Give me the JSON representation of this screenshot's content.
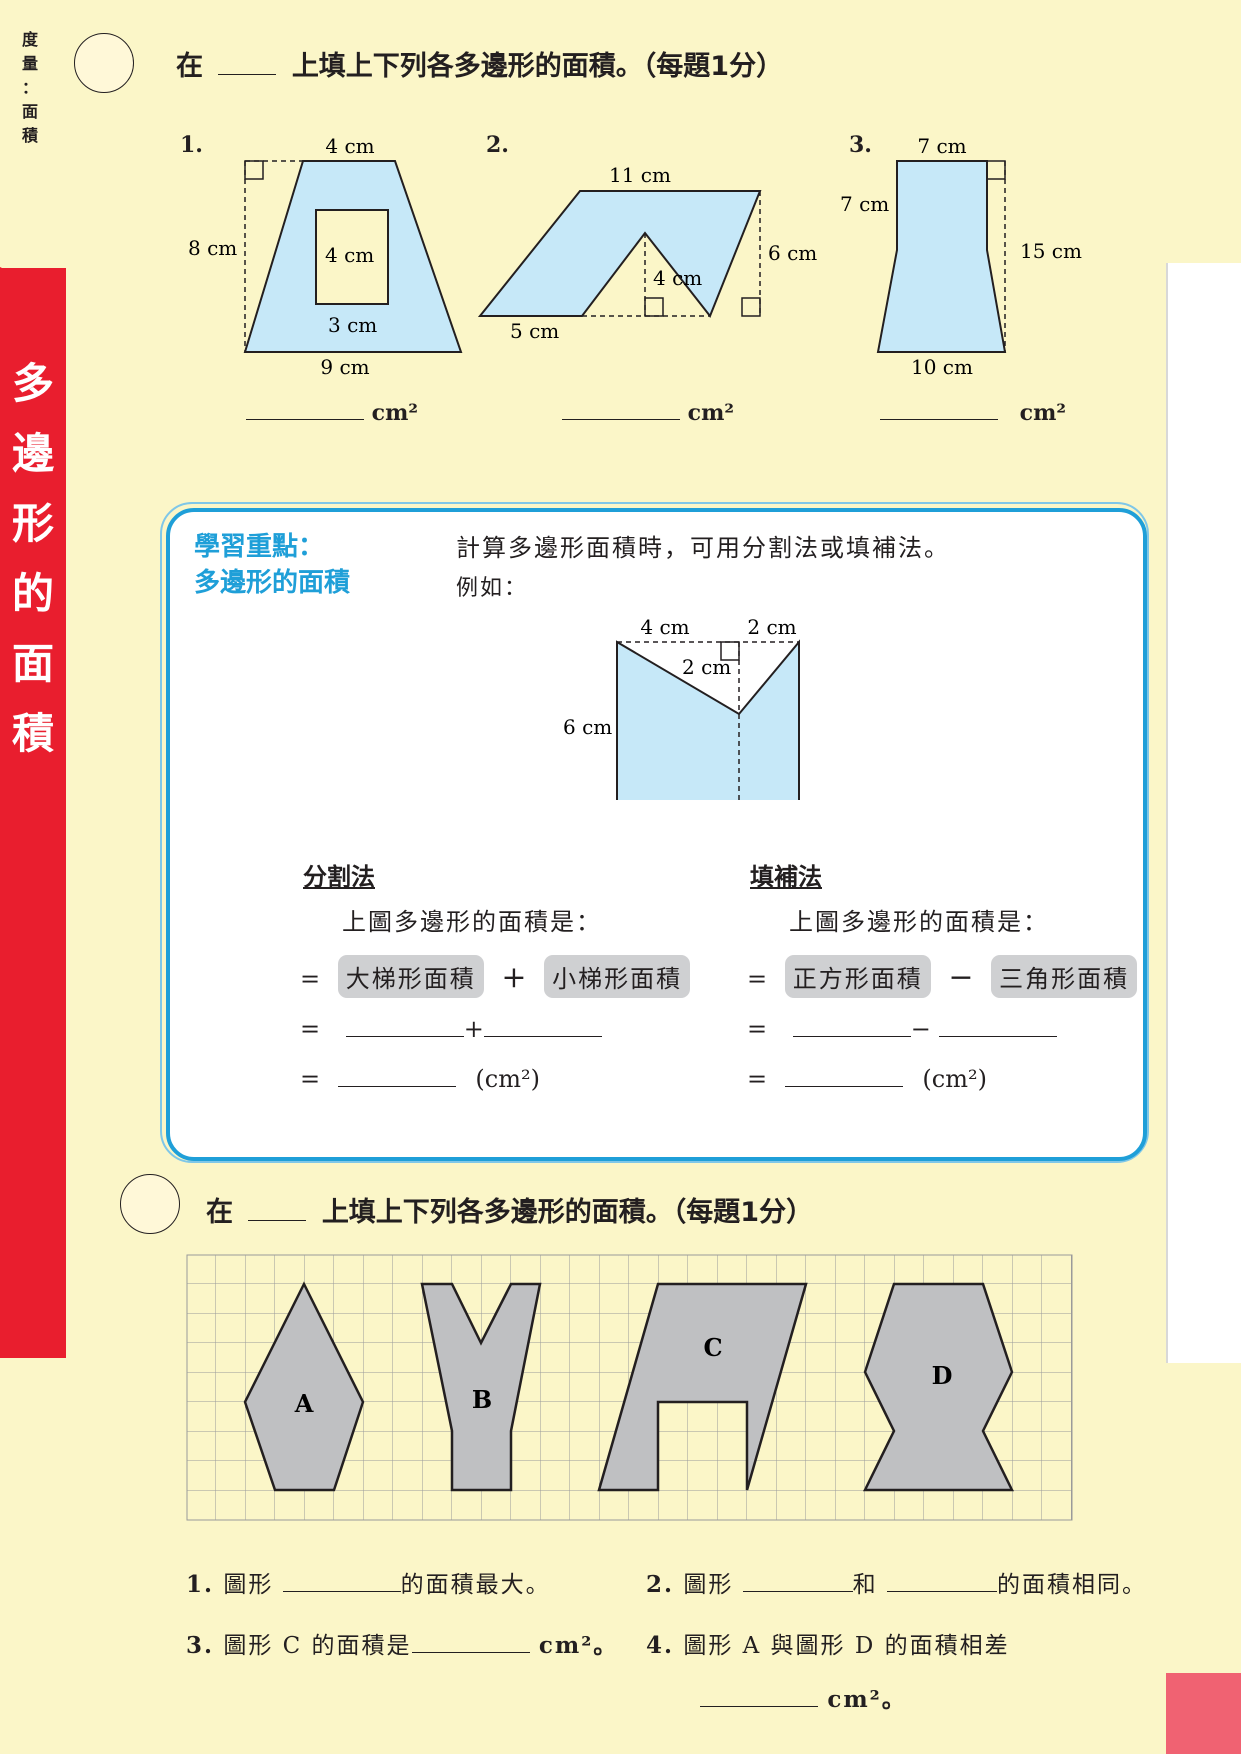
{
  "sidebar": {
    "top_chars": [
      "度",
      "量",
      "：",
      "面",
      "積"
    ],
    "tab_chars": [
      "多",
      "邊",
      "形",
      "的",
      "面",
      "積"
    ]
  },
  "section1": {
    "title_prefix": "在",
    "title_suffix": "上填上下列各多邊形的面積。（每題1分）",
    "questions": [
      {
        "num": "1.",
        "unit": "cm²",
        "labels": [
          "4 cm",
          "8 cm",
          "4 cm",
          "3 cm",
          "9 cm"
        ]
      },
      {
        "num": "2.",
        "unit": "cm²",
        "labels": [
          "11 cm",
          "6 cm",
          "4 cm",
          "5 cm"
        ]
      },
      {
        "num": "3.",
        "unit": "cm²",
        "labels": [
          "7 cm",
          "7 cm",
          "15 cm",
          "10 cm"
        ]
      }
    ]
  },
  "key_points": {
    "heading1": "學習重點：",
    "heading2": "多邊形的面積",
    "intro": "計算多邊形面積時，可用分割法或填補法。",
    "example": "例如：",
    "figure_labels": [
      "4 cm",
      "2 cm",
      "2 cm",
      "6 cm"
    ],
    "method1": {
      "name": "分割法",
      "stmt": "上圖多邊形的面積是：",
      "eq": "=",
      "term1": "大梯形面積",
      "op": "+",
      "term2": "小梯形面積",
      "unit": "(cm²)"
    },
    "method2": {
      "name": "填補法",
      "stmt": "上圖多邊形的面積是：",
      "eq": "=",
      "term1": "正方形面積",
      "op": "−",
      "term2": "三角形面積",
      "unit": "(cm²)"
    }
  },
  "section2": {
    "title_prefix": "在",
    "title_suffix": "上填上下列各多邊形的面積。（每題1分）",
    "shapes": [
      "A",
      "B",
      "C",
      "D"
    ],
    "q1": {
      "num": "1.",
      "a": "圖形",
      "b": "的面積最大。"
    },
    "q2": {
      "num": "2.",
      "a": "圖形",
      "b": "和",
      "c": "的面積相同。"
    },
    "q3": {
      "num": "3.",
      "a": "圖形 C 的面積是",
      "unit": "cm²。"
    },
    "q4": {
      "num": "4.",
      "a": "圖形 A 與圖形 D 的面積相差",
      "unit": "cm²。"
    }
  },
  "colors": {
    "shape_fill": "#c6e8f8",
    "grid_shape_fill": "#bfc0c2",
    "accent_blue": "#1f9fd8",
    "tab_red": "#e91e2e"
  }
}
